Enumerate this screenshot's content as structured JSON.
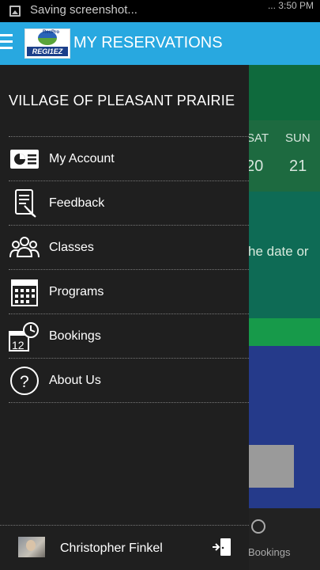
{
  "status_bar": {
    "notification_text": "Saving screenshot...",
    "right_text": "... 3:50 PM"
  },
  "app_bar": {
    "title": "MY RESERVATIONS",
    "logo_top_text": "RecPro",
    "logo_bottom_text": "REGI1EZ"
  },
  "background": {
    "day_labels": [
      "SAT",
      "SUN"
    ],
    "dates": [
      "20",
      "21"
    ],
    "hint_text": "he date or",
    "nav_tab_label": "Bookings"
  },
  "drawer": {
    "org_name": "VILLAGE OF PLEASANT PRAIRIE",
    "menu": [
      {
        "label": "My Account",
        "icon": "account-card-icon"
      },
      {
        "label": "Feedback",
        "icon": "feedback-icon"
      },
      {
        "label": "Classes",
        "icon": "classes-people-icon"
      },
      {
        "label": "Programs",
        "icon": "programs-calendar-icon"
      },
      {
        "label": "Bookings",
        "icon": "bookings-calendar-clock-icon"
      },
      {
        "label": "About Us",
        "icon": "about-question-icon"
      }
    ],
    "user_name": "Christopher Finkel"
  },
  "colors": {
    "app_bar": "#28a8e0",
    "drawer": "#1f1f1f",
    "divider": "#777777"
  }
}
